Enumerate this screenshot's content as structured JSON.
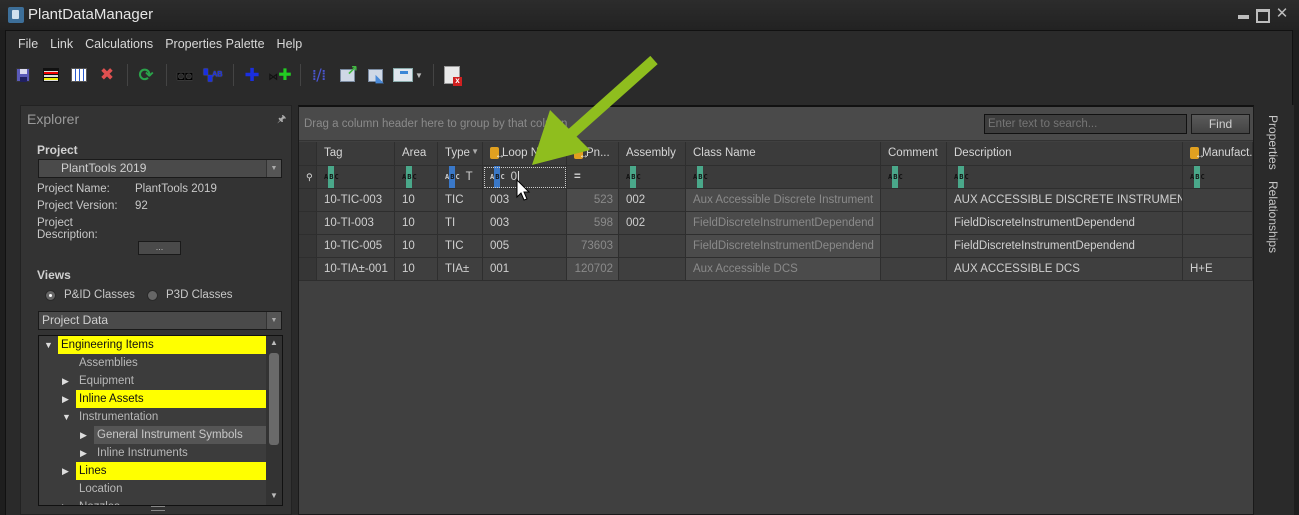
{
  "window": {
    "title": "PlantDataManager",
    "controls": [
      "minimize",
      "maximize",
      "close"
    ]
  },
  "menu": [
    "File",
    "Link",
    "Calculations",
    "Properties Palette",
    "Help"
  ],
  "toolbar": {
    "buttons": [
      {
        "name": "save",
        "icon": "floppy-disk-icon"
      },
      {
        "name": "rows",
        "icon": "rows-icon"
      },
      {
        "name": "columns",
        "icon": "columns-icon"
      },
      {
        "name": "delete",
        "icon": "red-x-icon"
      },
      {
        "name": "refresh",
        "icon": "green-refresh-icon"
      },
      {
        "name": "find",
        "icon": "binoculars-icon"
      },
      {
        "name": "find-replace",
        "icon": "binoculars-ab-icon"
      },
      {
        "name": "add",
        "icon": "blue-plus-icon"
      },
      {
        "name": "add-valve",
        "icon": "green-plus-valve-icon"
      },
      {
        "name": "grid-link",
        "icon": "grid-link-icon"
      },
      {
        "name": "export",
        "icon": "export-icon"
      },
      {
        "name": "import",
        "icon": "import-icon"
      },
      {
        "name": "layout",
        "icon": "layout-dropdown-icon"
      },
      {
        "name": "close-document",
        "icon": "close-document-icon"
      }
    ]
  },
  "explorer": {
    "title": "Explorer",
    "project_label": "Project",
    "project_selected": "PlantTools 2019",
    "info": [
      {
        "key": "Project Name:",
        "value": "PlantTools 2019"
      },
      {
        "key": "Project Version:",
        "value": "92"
      },
      {
        "key": "Project Description:",
        "value": ""
      }
    ],
    "ellipsis_button": "...",
    "views_label": "Views",
    "radio_options": [
      {
        "label": "P&ID Classes",
        "selected": true
      },
      {
        "label": "P3D Classes",
        "selected": false
      }
    ],
    "view_selected": "Project Data",
    "tree": [
      {
        "label": "Engineering Items",
        "level": 0,
        "expander": "expanded",
        "highlight": true,
        "selected": false
      },
      {
        "label": "Assemblies",
        "level": 1,
        "expander": "none",
        "highlight": false,
        "selected": false
      },
      {
        "label": "Equipment",
        "level": 1,
        "expander": "collapsed",
        "highlight": false,
        "selected": false
      },
      {
        "label": "Inline Assets",
        "level": 1,
        "expander": "collapsed",
        "highlight": true,
        "selected": false
      },
      {
        "label": "Instrumentation",
        "level": 1,
        "expander": "expanded",
        "highlight": false,
        "selected": false
      },
      {
        "label": "General Instrument Symbols",
        "level": 2,
        "expander": "collapsed",
        "highlight": false,
        "selected": true
      },
      {
        "label": "Inline Instruments",
        "level": 2,
        "expander": "collapsed",
        "highlight": false,
        "selected": false
      },
      {
        "label": "Lines",
        "level": 1,
        "expander": "collapsed",
        "highlight": true,
        "selected": false
      },
      {
        "label": "Location",
        "level": 1,
        "expander": "none",
        "highlight": false,
        "selected": false
      },
      {
        "label": "Nozzles",
        "level": 1,
        "expander": "collapsed",
        "highlight": false,
        "selected": false
      }
    ]
  },
  "grid": {
    "group_hint": "Drag a column header here to group by that column",
    "search_placeholder": "Enter text to search...",
    "find_label": "Find",
    "columns": [
      {
        "label": "Tag",
        "icon": "",
        "filtered": false
      },
      {
        "label": "Area",
        "icon": "",
        "filtered": false
      },
      {
        "label": "Type",
        "icon": "",
        "filtered": true
      },
      {
        "label": "Loop N...",
        "icon": "db-link-icon",
        "filtered": false
      },
      {
        "label": "Pn...",
        "icon": "db-key-icon",
        "filtered": false
      },
      {
        "label": "Assembly",
        "icon": "",
        "filtered": false
      },
      {
        "label": "Class Name",
        "icon": "",
        "filtered": false
      },
      {
        "label": "Comment",
        "icon": "",
        "filtered": false
      },
      {
        "label": "Description",
        "icon": "",
        "filtered": false
      },
      {
        "label": "Manufact...",
        "icon": "db-link-icon",
        "filtered": false
      }
    ],
    "filter_row": [
      {
        "type": "abc",
        "value": ""
      },
      {
        "type": "abc",
        "value": ""
      },
      {
        "type": "abc-active",
        "value": "T"
      },
      {
        "type": "abc-active",
        "value": "0"
      },
      {
        "type": "equals",
        "value": "="
      },
      {
        "type": "abc",
        "value": ""
      },
      {
        "type": "abc",
        "value": ""
      },
      {
        "type": "abc",
        "value": ""
      },
      {
        "type": "abc",
        "value": ""
      },
      {
        "type": "abc",
        "value": ""
      }
    ],
    "rows": [
      [
        "10-TIC-003",
        "10",
        "TIC",
        "003",
        "523",
        "002",
        "Aux Accessible Discrete Instrument",
        "",
        "AUX ACCESSIBLE DISCRETE INSTRUMENT",
        ""
      ],
      [
        "10-TI-003",
        "10",
        "TI",
        "003",
        "598",
        "002",
        "FieldDiscreteInstrumentDependend",
        "",
        "FieldDiscreteInstrumentDependend",
        ""
      ],
      [
        "10-TIC-005",
        "10",
        "TIC",
        "005",
        "73603",
        "",
        "FieldDiscreteInstrumentDependend",
        "",
        "FieldDiscreteInstrumentDependend",
        ""
      ],
      [
        "10-TIA±-001",
        "10",
        "TIA±",
        "001",
        "120702",
        "",
        "Aux Accessible DCS",
        "",
        "AUX ACCESSIBLE DCS",
        "H+E"
      ]
    ]
  },
  "side_tabs": [
    "Properties",
    "Relationships"
  ],
  "annotation": {
    "arrow_color": "#8fbe1e"
  }
}
